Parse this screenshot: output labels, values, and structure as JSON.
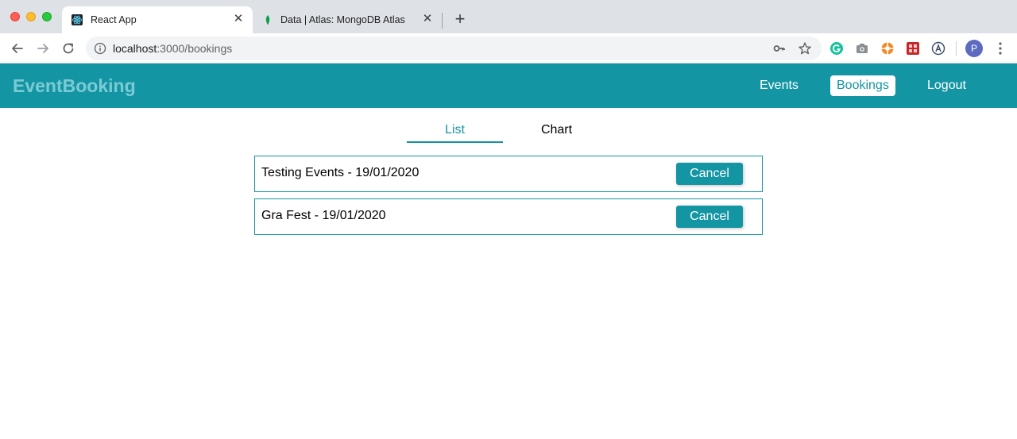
{
  "browser": {
    "tabs": [
      {
        "title": "React App",
        "icon": "react-icon",
        "active": true
      },
      {
        "title": "Data | Atlas: MongoDB Atlas",
        "icon": "mongodb-leaf-icon",
        "active": false
      }
    ],
    "url_host": "localhost",
    "url_path": ":3000/bookings",
    "profile_initial": "P"
  },
  "app": {
    "brand": "EventBooking",
    "nav": {
      "events": "Events",
      "bookings": "Bookings",
      "logout": "Logout"
    },
    "active_nav": "Bookings",
    "view_tabs": {
      "list": "List",
      "chart": "Chart"
    },
    "active_view": "List",
    "bookings": [
      {
        "label": "Testing Events - 19/01/2020",
        "action": "Cancel"
      },
      {
        "label": "Gra Fest - 19/01/2020",
        "action": "Cancel"
      }
    ]
  },
  "colors": {
    "accent": "#1495a4",
    "brand_text": "#7ccbd4"
  }
}
